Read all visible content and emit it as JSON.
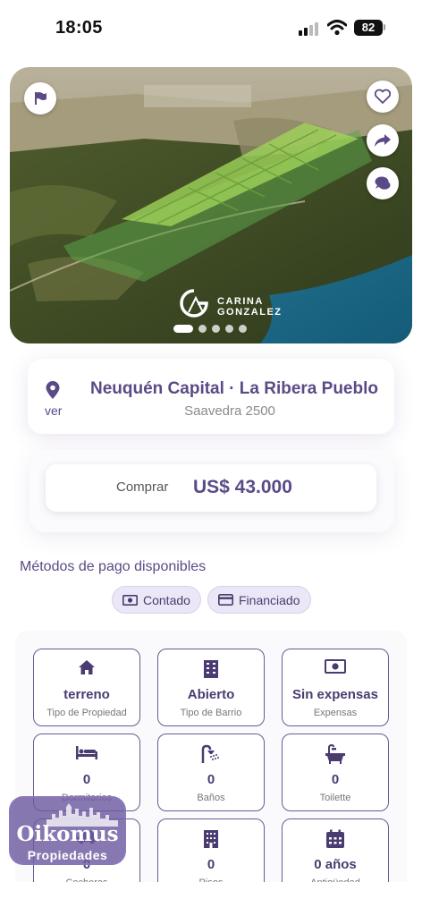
{
  "status_bar": {
    "time": "18:05",
    "battery": "82"
  },
  "hero": {
    "brand_line1": "CARINA",
    "brand_line2": "GONZALEZ",
    "slide_count": 5,
    "active_slide": 1
  },
  "location": {
    "title": "Neuquén Capital · La Ribera Pueblo",
    "address": "Saavedra 2500",
    "map_link": "ver"
  },
  "price": {
    "operation": "Comprar",
    "amount": "US$ 43.000"
  },
  "payment": {
    "title": "Métodos de pago disponibles",
    "methods": [
      {
        "label": "Contado",
        "icon": "cash-icon"
      },
      {
        "label": "Financiado",
        "icon": "credit-card-icon"
      }
    ]
  },
  "features": [
    {
      "value": "terreno",
      "label": "Tipo de Propiedad",
      "icon": "home-icon"
    },
    {
      "value": "Abierto",
      "label": "Tipo de Barrio",
      "icon": "building-icon"
    },
    {
      "value": "Sin expensas",
      "label": "Expensas",
      "icon": "cash-icon"
    },
    {
      "value": "0",
      "label": "Dormitorios",
      "icon": "bed-icon"
    },
    {
      "value": "0",
      "label": "Baños",
      "icon": "shower-icon"
    },
    {
      "value": "0",
      "label": "Toilette",
      "icon": "bathtub-icon"
    },
    {
      "value": "0",
      "label": "Cocheras",
      "icon": "car-icon"
    },
    {
      "value": "0",
      "label": "Pisos",
      "icon": "floors-icon"
    },
    {
      "value": "0 años",
      "label": "Antigüedad",
      "icon": "calendar-icon"
    }
  ],
  "overlay_logo": {
    "name": "Oikomus",
    "subtitle": "Propiedades"
  },
  "colors": {
    "accent": "#5b4a86",
    "chip_bg": "#ece7f6",
    "logo_bg": "#6e5aa0"
  }
}
